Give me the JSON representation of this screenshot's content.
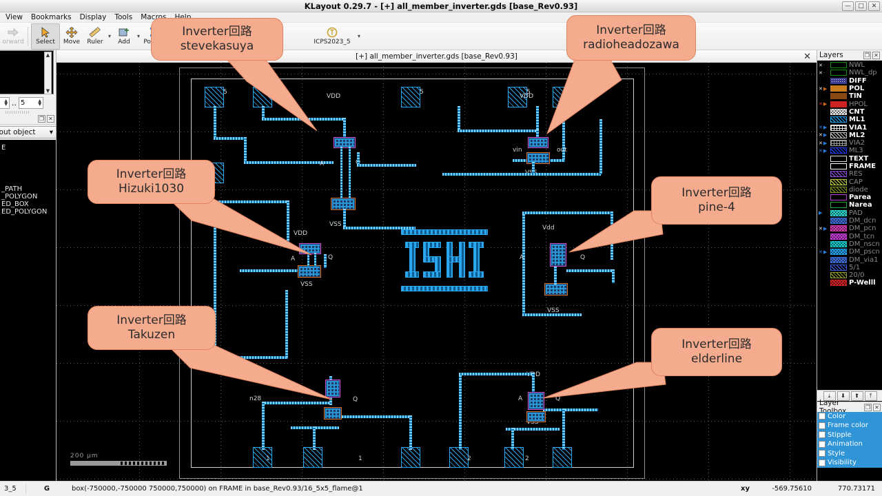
{
  "window": {
    "title": "KLayout 0.29.7 - [+] all_member_inverter.gds [base_Rev0.93]",
    "minimize": "—",
    "maximize": "□",
    "close": "✕"
  },
  "menubar": {
    "items": [
      {
        "label": "View"
      },
      {
        "label": "Bookmarks"
      },
      {
        "label": "Display"
      },
      {
        "label": "Tools"
      },
      {
        "label": "Macros"
      },
      {
        "label": "Help"
      }
    ]
  },
  "toolbar": {
    "items": [
      {
        "label": "orward",
        "name": "forward-button",
        "state": "disabled"
      },
      {
        "label": "Select",
        "name": "select-tool",
        "state": "active"
      },
      {
        "label": "Move",
        "name": "move-tool",
        "state": "normal"
      },
      {
        "label": "Ruler",
        "name": "ruler-tool",
        "state": "normal"
      },
      {
        "label": "Add",
        "name": "add-tool",
        "state": "normal"
      },
      {
        "label": "Polygon",
        "name": "polygon-tool",
        "state": "normal"
      }
    ],
    "tech_label": "ICPS2023_5"
  },
  "left_panel": {
    "range_from": "",
    "range_sep": "..",
    "range_to": "5",
    "combo_value": "ic layout object",
    "list": [
      "E",
      "",
      "_PATH",
      "_POLYGON",
      "ED_BOX",
      "ED_POLYGON"
    ]
  },
  "document": {
    "tab_label": "[+] all_member_inverter.gds [base_Rev0.93]",
    "close_label": "✕"
  },
  "canvas": {
    "center_text": "ISHI",
    "scale_label": "200 µm",
    "net_labels": {
      "vdd": "VDD",
      "vss": "VSS",
      "a": "A",
      "q": "Q",
      "vdd_lc": "Vdd",
      "out": "out",
      "vin": "vin",
      "n28": "n28"
    },
    "pad_labels": [
      "5",
      "5",
      "5",
      "5",
      "1",
      "1",
      "2",
      "2"
    ]
  },
  "callouts": [
    {
      "name": "callout-stevekasuya",
      "line1": "Inverter回路",
      "line2": "stevekasuya"
    },
    {
      "name": "callout-radioheadozawa",
      "line1": "Inverter回路",
      "line2": "radioheadozawa"
    },
    {
      "name": "callout-hizuki1030",
      "line1": "Inverter回路",
      "line2": "Hizuki1030"
    },
    {
      "name": "callout-pine4",
      "line1": "Inverter回路",
      "line2": "pine-4"
    },
    {
      "name": "callout-takuzen",
      "line1": "Inverter回路",
      "line2": "Takuzen"
    },
    {
      "name": "callout-elderline",
      "line1": "Inverter回路",
      "line2": "elderline"
    }
  ],
  "layers_panel": {
    "title": "Layers",
    "items": [
      {
        "name": "NWL",
        "visible": false,
        "color": "#0b8f0b",
        "fill": "none",
        "marks": "x."
      },
      {
        "name": "NWL_dp",
        "visible": false,
        "color": "#0b8f0b",
        "fill": "none",
        "marks": "x."
      },
      {
        "name": "DIFF",
        "visible": true,
        "color": "#3b3b8f",
        "fill": "dots",
        "marks": ""
      },
      {
        "name": "POL",
        "visible": true,
        "color": "#c87a1e",
        "fill": "solid",
        "marks": "x>"
      },
      {
        "name": "TIN",
        "visible": true,
        "color": "#8a4a12",
        "fill": "solid",
        "marks": ""
      },
      {
        "name": "HPOL",
        "visible": false,
        "color": "#cc2222",
        "fill": "solid",
        "marks": "x>"
      },
      {
        "name": "CNT",
        "visible": true,
        "color": "#dddddd",
        "fill": "cross",
        "marks": ""
      },
      {
        "name": "ML1",
        "visible": true,
        "color": "#1f9fe8",
        "fill": "diag",
        "marks": ""
      },
      {
        "name": "VIA1",
        "visible": true,
        "color": "#e8e8e8",
        "fill": "grid",
        "marks": "x>"
      },
      {
        "name": "ML2",
        "visible": true,
        "color": "#bdbdbd",
        "fill": "diag",
        "marks": "x>"
      },
      {
        "name": "VIA2",
        "visible": false,
        "color": "#9a9a9a",
        "fill": "grid",
        "marks": "x>"
      },
      {
        "name": "ML3",
        "visible": false,
        "color": "#1b3ce8",
        "fill": "diag",
        "marks": "x>"
      },
      {
        "name": "TEXT",
        "visible": true,
        "color": "#dcdcdc",
        "fill": "none",
        "marks": ""
      },
      {
        "name": "FRAME",
        "visible": true,
        "color": "#ffffff",
        "fill": "none",
        "marks": ""
      },
      {
        "name": "RES",
        "visible": false,
        "color": "#8a4ad0",
        "fill": "diag",
        "marks": ""
      },
      {
        "name": "CAP",
        "visible": false,
        "color": "#b8c83c",
        "fill": "diag",
        "marks": ""
      },
      {
        "name": "diode",
        "visible": false,
        "color": "#7d8f1e",
        "fill": "diag",
        "marks": ""
      },
      {
        "name": "Parea",
        "visible": true,
        "color": "#b03cd0",
        "fill": "none",
        "marks": ""
      },
      {
        "name": "Narea",
        "visible": true,
        "color": "#1ea83c",
        "fill": "none",
        "marks": ""
      },
      {
        "name": "PAD",
        "visible": false,
        "color": "#2ad0c8",
        "fill": "cross",
        "marks": ">"
      },
      {
        "name": "DM_dcn",
        "visible": false,
        "color": "#3c6ad0",
        "fill": "cross",
        "marks": ""
      },
      {
        "name": "DM_pcn",
        "visible": false,
        "color": "#d03cb0",
        "fill": "cross",
        "marks": "x>"
      },
      {
        "name": "DM_tcn",
        "visible": false,
        "color": "#c03cd0",
        "fill": "cross",
        "marks": ""
      },
      {
        "name": "DM_nscn",
        "visible": false,
        "color": "#18c8c8",
        "fill": "cross",
        "marks": ""
      },
      {
        "name": "DM_pscn",
        "visible": false,
        "color": "#1f9fe8",
        "fill": "cross",
        "marks": "x>"
      },
      {
        "name": "DM_via1",
        "visible": false,
        "color": "#3c6ad0",
        "fill": "cross",
        "marks": ""
      },
      {
        "name": "5/1",
        "visible": false,
        "color": "#3c5ad0",
        "fill": "diag",
        "marks": ""
      },
      {
        "name": "20/0",
        "visible": false,
        "color": "#8a9a2a",
        "fill": "diag",
        "marks": ""
      },
      {
        "name": "P-Welll",
        "visible": true,
        "color": "#cc2222",
        "fill": "cross",
        "marks": ""
      }
    ]
  },
  "layer_toolbox": {
    "title": "Layer Toolbox",
    "items": [
      "Color",
      "Frame color",
      "Stipple",
      "Animation",
      "Style",
      "Visibility"
    ]
  },
  "statusbar": {
    "left": "3_5",
    "mode": "G",
    "message": "box(-750000,-750000 750000,750000) on FRAME in base_Rev0.93/16_5x5_flame@1",
    "xy_label": "xy",
    "x": "-569.75610",
    "y": "770.73171"
  }
}
